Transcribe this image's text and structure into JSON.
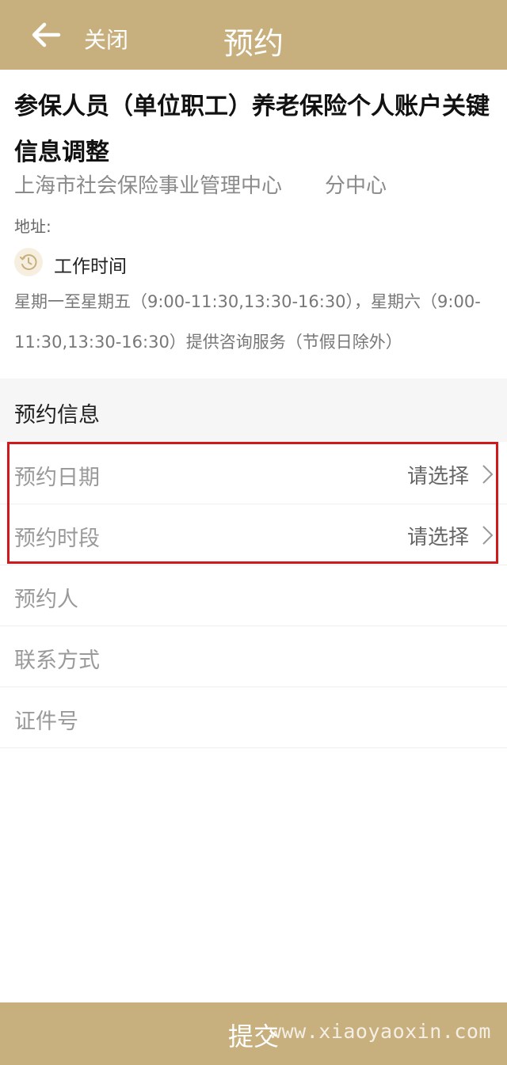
{
  "nav": {
    "close_label": "关闭",
    "title": "预约"
  },
  "service": {
    "title": "参保人员（单位职工）养老保险个人账户关键信息调整",
    "agency": "上海市社会保险事业管理中心",
    "sub_agency": "分中心",
    "address_label": "地址:",
    "work_time_label": "工作时间",
    "work_time_text": "星期一至星期五（9:00-11:30,13:30-16:30），星期六（9:00-11:30,13:30-16:30）提供咨询服务（节假日除外）"
  },
  "section": {
    "title": "预约信息"
  },
  "form": {
    "date": {
      "label": "预约日期",
      "value": "请选择"
    },
    "period": {
      "label": "预约时段",
      "value": "请选择"
    },
    "person": {
      "label": "预约人"
    },
    "contact": {
      "label": "联系方式"
    },
    "id_number": {
      "label": "证件号"
    }
  },
  "footer": {
    "submit_label": "提交",
    "watermark": "www.xiaoyaoxin.com"
  },
  "colors": {
    "brand": "#c8b07e",
    "highlight": "#d0191b"
  }
}
